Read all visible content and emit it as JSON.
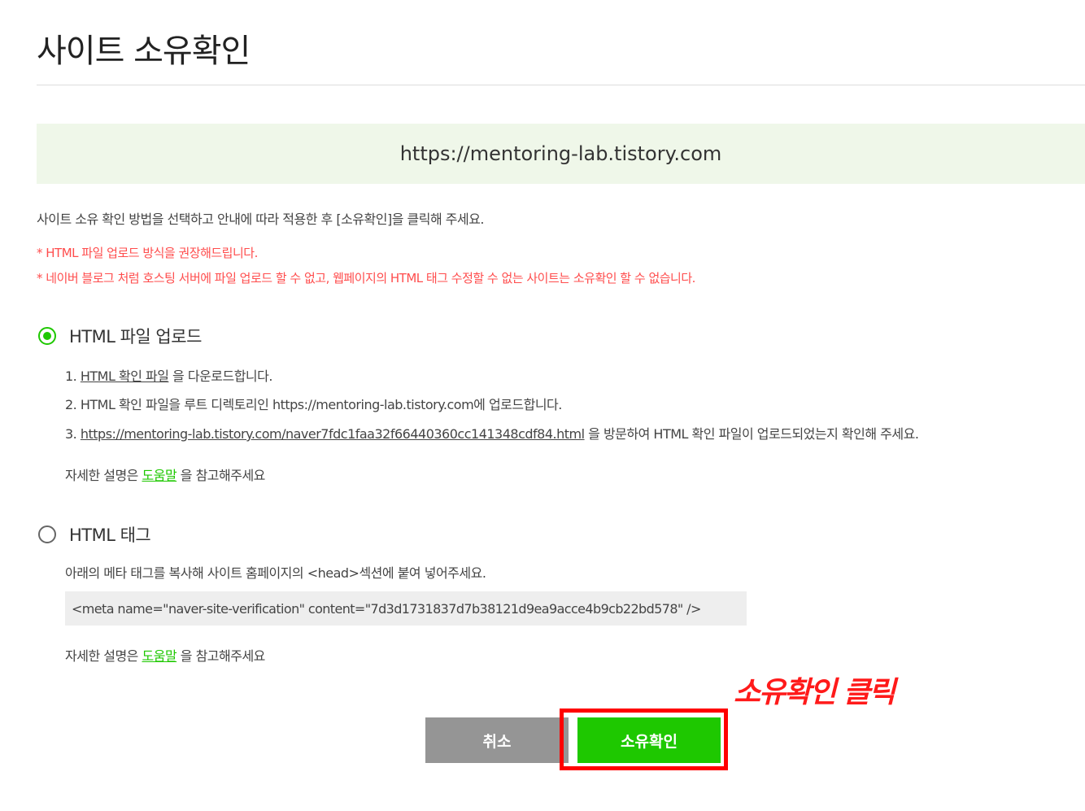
{
  "page": {
    "title": "사이트 소유확인",
    "site_url": "https://mentoring-lab.tistory.com",
    "instruction": "사이트 소유 확인 방법을 선택하고 안내에 따라 적용한 후 [소유확인]을 클릭해 주세요.",
    "notices": [
      "* HTML 파일 업로드 방식을 권장해드립니다.",
      "* 네이버 블로그 처럼 호스팅 서버에 파일 업로드 할 수 없고, 웹페이지의 HTML 태그 수정할 수 없는 사이트는 소유확인 할 수 없습니다."
    ]
  },
  "option_html_file": {
    "label": "HTML 파일 업로드",
    "selected": true,
    "step1_prefix": "1. ",
    "step1_link": "HTML 확인 파일",
    "step1_suffix": " 을 다운로드합니다.",
    "step2": "2. HTML 확인 파일을 루트 디렉토리인 https://mentoring-lab.tistory.com에 업로드합니다.",
    "step3_prefix": "3. ",
    "step3_link": "https://mentoring-lab.tistory.com/naver7fdc1faa32f66440360cc141348cdf84.html",
    "step3_suffix": " 을 방문하여 HTML 확인 파일이 업로드되었는지 확인해 주세요.",
    "help_prefix": "자세한 설명은 ",
    "help_link": "도움말",
    "help_suffix": " 을 참고해주세요"
  },
  "option_html_tag": {
    "label": "HTML 태그",
    "selected": false,
    "description": "아래의 메타 태그를 복사해 사이트 홈페이지의 <head>섹션에 붙여 넣어주세요.",
    "meta_tag": "<meta name=\"naver-site-verification\" content=\"7d3d1731837d7b38121d9ea9acce4b9cb22bd578\" />",
    "help_prefix": "자세한 설명은 ",
    "help_link": "도움말",
    "help_suffix": " 을 참고해주세요"
  },
  "buttons": {
    "cancel": "취소",
    "confirm": "소유확인"
  },
  "annotation": "소유확인 클릭",
  "colors": {
    "accent": "#1ec800",
    "notice": "#ff4d4d",
    "highlight": "#ff0000",
    "banner_bg": "#eff7e9",
    "cancel_bg": "#959595"
  }
}
